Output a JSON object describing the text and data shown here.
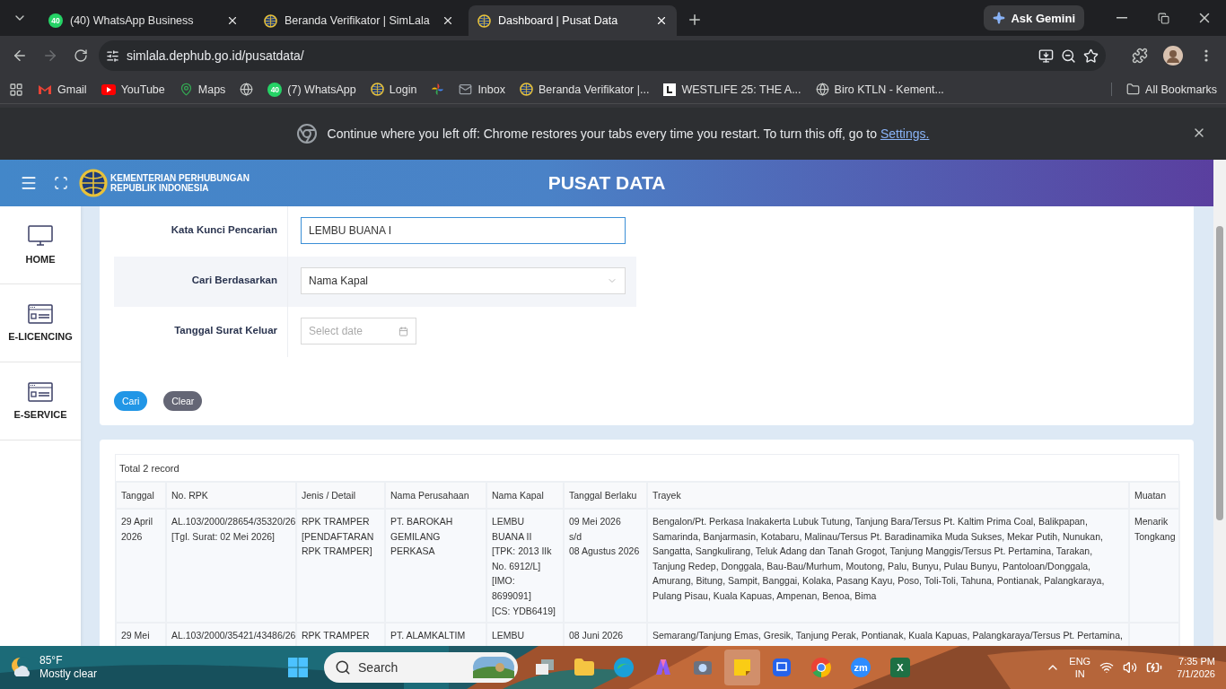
{
  "browser": {
    "tabs": [
      {
        "title": "(40) WhatsApp Business",
        "badge": "40",
        "kind": "whatsapp",
        "selected": false
      },
      {
        "title": "Beranda Verifikator | SimLala",
        "kind": "emblem",
        "selected": false
      },
      {
        "title": "Dashboard | Pusat Data",
        "kind": "emblem",
        "selected": true
      }
    ],
    "ask_gemini": "Ask Gemini",
    "url": "simlala.dephub.go.id/pusatdata/",
    "bookmarks": [
      {
        "label": "Gmail",
        "kind": "gmail"
      },
      {
        "label": "YouTube",
        "kind": "youtube"
      },
      {
        "label": "Maps",
        "kind": "maps"
      },
      {
        "kind": "globe"
      },
      {
        "label": "(7) WhatsApp",
        "kind": "whatsapp",
        "badge": "40"
      },
      {
        "label": "Login",
        "kind": "emblem"
      },
      {
        "kind": "pinwheel"
      },
      {
        "label": "Inbox",
        "kind": "mail"
      },
      {
        "label": "Beranda Verifikator |...",
        "kind": "emblem"
      },
      {
        "label": "WESTLIFE 25: THE A...",
        "kind": "square"
      },
      {
        "label": "Biro KTLN - Kement...",
        "kind": "globe"
      }
    ],
    "all_bookmarks": "All Bookmarks",
    "infobar": {
      "message": "Continue where you left off: Chrome restores your tabs every time you restart. To turn this off, go to",
      "link": "Settings."
    }
  },
  "header": {
    "org_line_1": "KEMENTERIAN PERHUBUNGAN",
    "org_line_2": "REPUBLIK INDONESIA",
    "title": "PUSAT DATA"
  },
  "sidebar": [
    {
      "label": "HOME",
      "kind": "monitor"
    },
    {
      "label": "E-LICENCING",
      "kind": "form"
    },
    {
      "label": "E-SERVICE",
      "kind": "form"
    }
  ],
  "form": {
    "fields": [
      {
        "label": "Kata Kunci Pencarian",
        "kind": "text",
        "value": "LEMBU BUANA I",
        "focused": true
      },
      {
        "label": "Cari Berdasarkan",
        "kind": "select",
        "value": "Nama Kapal",
        "focused": false
      },
      {
        "label": "Tanggal Surat Keluar",
        "kind": "date",
        "placeholder": "Select date",
        "focused": false
      }
    ],
    "buttons": [
      {
        "label": "Cari",
        "kind": "primary"
      },
      {
        "label": "Clear",
        "kind": "secondary"
      }
    ]
  },
  "results": {
    "total": "Total 2 record",
    "columns": [
      "Tanggal",
      "No. RPK",
      "Jenis / Detail",
      "Nama Perusahaan",
      "Nama Kapal",
      "Tanggal Berlaku",
      "Trayek",
      "Muatan"
    ],
    "rows": [
      [
        "29 April 2026",
        "AL.103/2000/28654/35320/26\n[Tgl. Surat: 02 Mei 2026]",
        "RPK TRAMPER [PENDAFTARAN RPK TRAMPER]",
        "PT. BAROKAH GEMILANG PERKASA",
        "LEMBU\nBUANA II\n[TPK: 2013 IIk\nNo. 6912/L]\n[IMO:\n8699091]\n[CS: YDB6419]",
        "09 Mei 2026\ns/d\n08 Agustus 2026",
        "Bengalon/Pt. Perkasa Inakakerta Lubuk Tutung, Tanjung Bara/Tersus Pt. Kaltim Prima Coal, Balikpapan, Samarinda, Banjarmasin, Kotabaru, Malinau/Tersus Pt. Baradinamika Muda Sukses, Mekar Putih, Nunukan, Sangatta, Sangkulirang, Teluk Adang dan Tanah Grogot, Tanjung Manggis/Tersus Pt. Pertamina, Tarakan, Tanjung Redep, Donggala, Bau-Bau/Murhum, Moutong, Palu, Bunyu, Pulau Bunyu, Pantoloan/Donggala, Amurang, Bitung, Sampit, Banggai, Kolaka, Pasang Kayu, Poso, Toli-Toli, Tahuna, Pontianak, Palangkaraya, Pulang Pisau, Kuala Kapuas, Ampenan, Benoa, Bima",
        "Menarik Tongkang"
      ],
      [
        "29 Mei",
        "AL.103/2000/35421/43486/26",
        "RPK TRAMPER",
        "PT. ALAMKALTIM",
        "LEMBU",
        "08 Juni 2026",
        "Semarang/Tanjung Emas, Gresik, Tanjung Perak, Pontianak, Kuala Kapuas, Palangkaraya/Tersus Pt. Pertamina,"
      ]
    ]
  },
  "taskbar": {
    "temperature": "85°F",
    "weather": "Mostly clear",
    "search": "Search",
    "apps": [
      {
        "kind": "taskview",
        "selected": false
      },
      {
        "kind": "folder",
        "selected": false
      },
      {
        "kind": "edge",
        "selected": false
      },
      {
        "kind": "copilot",
        "selected": false
      },
      {
        "kind": "camera",
        "selected": false
      },
      {
        "kind": "notes",
        "selected": true
      },
      {
        "kind": "remote",
        "selected": false
      },
      {
        "kind": "chrome",
        "selected": false
      },
      {
        "kind": "zoom",
        "glyph": "zm",
        "selected": false
      },
      {
        "kind": "excel",
        "glyph": "X",
        "selected": false
      }
    ],
    "language": "ENG",
    "region": "IN",
    "time": "7:35 PM",
    "date": "7/1/2026"
  }
}
